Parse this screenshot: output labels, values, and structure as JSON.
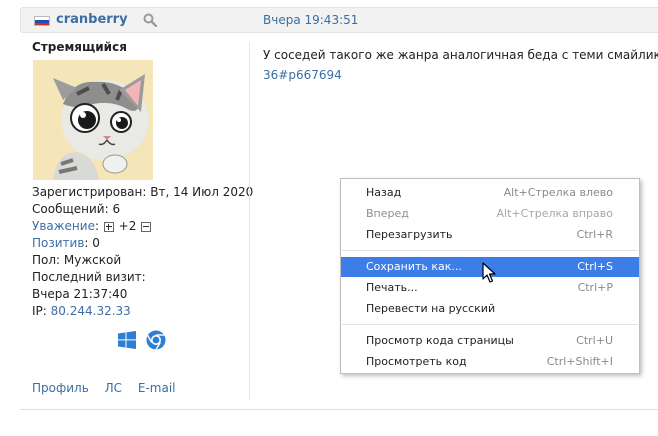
{
  "post": {
    "author": "cranberry",
    "time": "Вчера 19:43:51",
    "message_line1": "У соседей такого же жанра аналогичная беда с теми смайликами,",
    "message_line2": "36#p667694"
  },
  "user": {
    "rank": "Стремящийся",
    "registered": "Зарегистрирован: Вт, 14 Июл 2020",
    "messages": "Сообщений: 6",
    "respect_label": "Уважение",
    "respect_value": "+2",
    "positive_label": "Позитив",
    "positive_value": ": 0",
    "gender": "Пол: Мужской",
    "last_visit_label": "Последний визит:",
    "last_visit_value": "Вчера 21:37:40",
    "ip_label": "IP:",
    "ip_value": "80.244.32.33"
  },
  "profile_links": {
    "profile": "Профиль",
    "pm": "ЛС",
    "email": "E-mail"
  },
  "context_menu": {
    "items": [
      {
        "label": "Назад",
        "shortcut": "Alt+Стрелка влево",
        "disabled": false
      },
      {
        "label": "Вперед",
        "shortcut": "Alt+Стрелка вправо",
        "disabled": true
      },
      {
        "label": "Перезагрузить",
        "shortcut": "Ctrl+R",
        "disabled": false
      },
      {
        "label": "Сохранить как...",
        "shortcut": "Ctrl+S",
        "active": true
      },
      {
        "label": "Печать...",
        "shortcut": "Ctrl+P",
        "disabled": false
      },
      {
        "label": "Перевести на русский",
        "shortcut": "",
        "disabled": false
      },
      {
        "label": "Просмотр кода страницы",
        "shortcut": "Ctrl+U",
        "disabled": false
      },
      {
        "label": "Просмотреть код",
        "shortcut": "Ctrl+Shift+I",
        "disabled": false
      }
    ]
  },
  "icons": {
    "flag": "russia-flag-icon",
    "search": "search-icon",
    "os": "windows-icon",
    "browser": "chrome-icon",
    "cursor": "mouse-cursor-icon"
  },
  "colors": {
    "link": "#3b6ea5",
    "menu_highlight": "#3c7de8"
  }
}
